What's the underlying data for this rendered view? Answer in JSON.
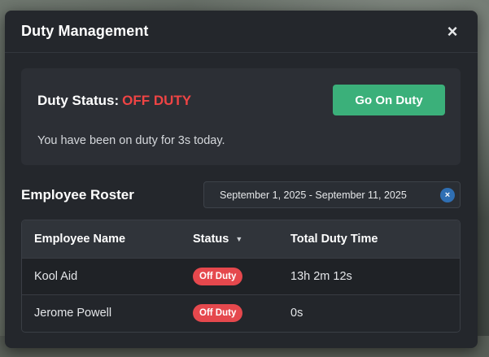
{
  "window": {
    "title": "Duty Management",
    "close_icon": "×"
  },
  "status": {
    "label": "Duty Status:",
    "value": "OFF DUTY",
    "value_color": "#ef4444",
    "action_label": "Go On Duty",
    "action_color": "#3bb07a",
    "message": "You have been on duty for 3s today."
  },
  "roster": {
    "title": "Employee Roster",
    "date_range": "September 1, 2025 - September 11, 2025",
    "date_clear_icon": "×",
    "columns": {
      "name": "Employee Name",
      "status": "Status",
      "time": "Total Duty Time"
    },
    "sort_icon": "▼",
    "rows": [
      {
        "name": "Kool Aid",
        "status": "Off Duty",
        "time": "13h 2m 12s"
      },
      {
        "name": "Jerome Powell",
        "status": "Off Duty",
        "time": "0s"
      }
    ]
  }
}
